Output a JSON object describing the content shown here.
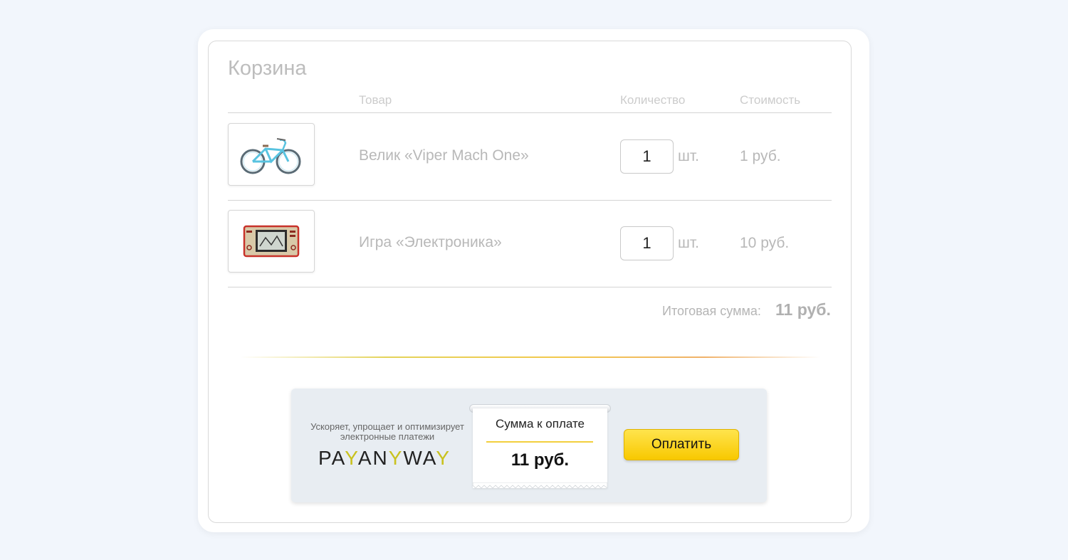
{
  "cart": {
    "title": "Корзина",
    "columns": {
      "product": "Товар",
      "quantity": "Количество",
      "cost": "Стоимость"
    },
    "items": [
      {
        "name": "Велик «Viper Mach One»",
        "quantity": "1",
        "unit": "шт.",
        "price": "1 руб.",
        "image": "bicycle-image"
      },
      {
        "name": "Игра «Электроника»",
        "quantity": "1",
        "unit": "шт.",
        "price": "10 руб.",
        "image": "handheld-game-image"
      }
    ],
    "total_label": "Итоговая сумма:",
    "total_value": "11 руб."
  },
  "payment": {
    "tagline": "Ускоряет, упрощает и оптимизирует электронные платежи",
    "logo_text": "PAYANYWAY",
    "receipt_label": "Сумма к оплате",
    "receipt_amount": "11 руб.",
    "pay_button": "Оплатить"
  },
  "colors": {
    "background": "#f2f6fc",
    "button": "#f8c800",
    "accent_line": "#f2cf3d"
  }
}
